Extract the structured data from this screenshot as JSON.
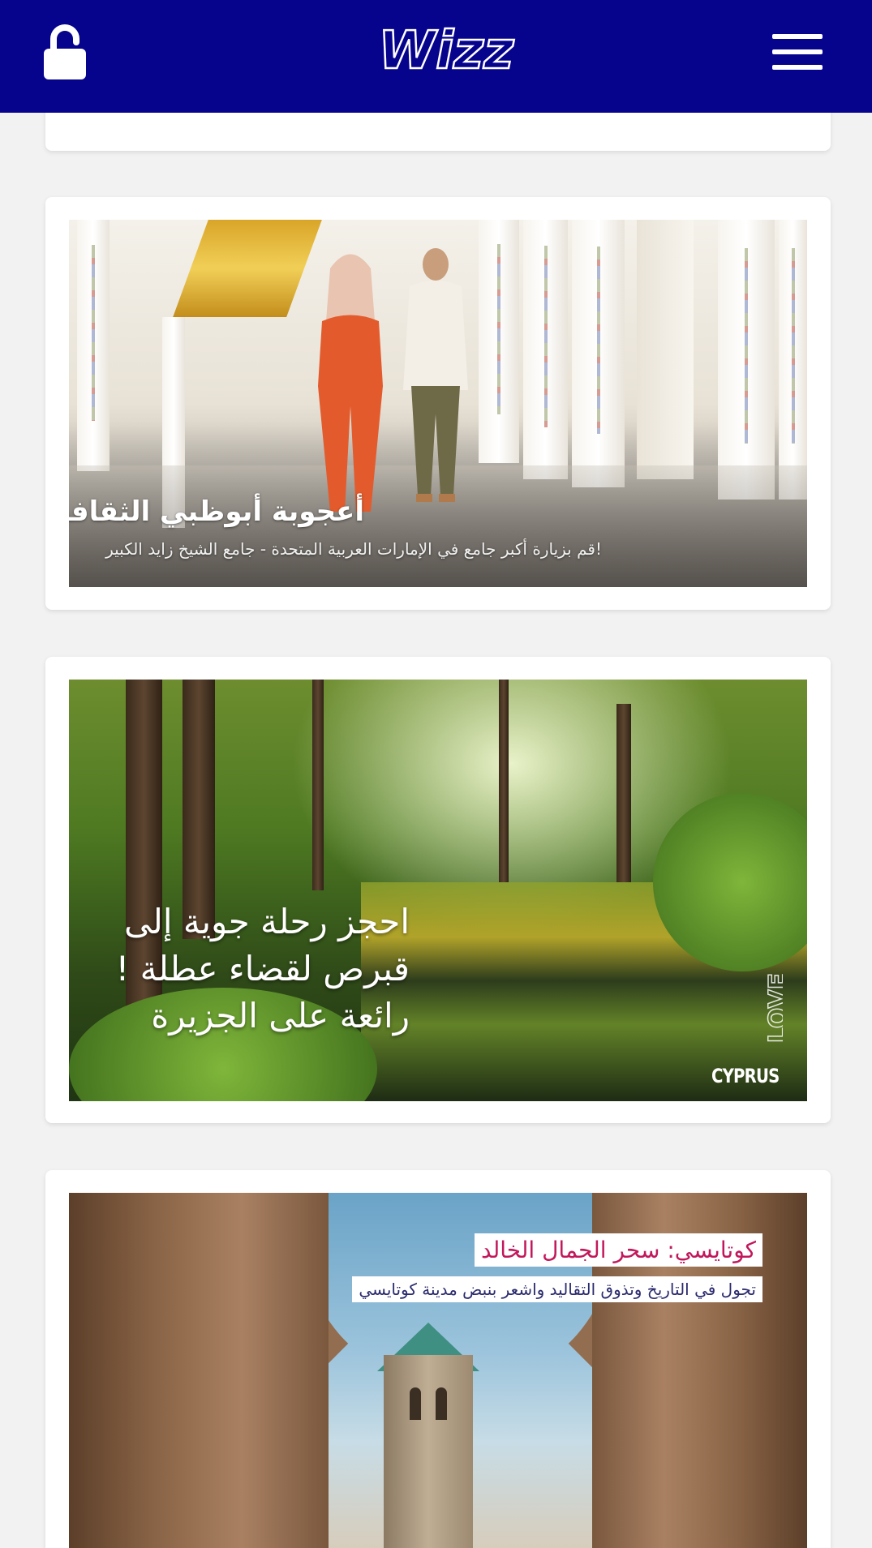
{
  "header": {
    "lock_icon": "unlock-icon",
    "logo_text": "Wizz",
    "menu_icon": "hamburger-menu-icon",
    "background_color": "#06038d"
  },
  "cards": [
    {
      "title": "أعجوبة أبوظبي الثقافية",
      "subtitle": "!قم بزيارة أكبر جامع في الإمارات العربية المتحدة - جامع الشيخ زايد الكبير"
    },
    {
      "title": "احجز رحلة جوية إلى قبرص لقضاء عطلة !رائعة على الجزيرة",
      "badge_logo_text": "LOVE",
      "badge_text": "CYPRUS"
    },
    {
      "title": "كوتايسي: سحر الجمال الخالد",
      "subtitle": "تجول في التاريخ وتذوق التقاليد واشعر بنبض مدينة كوتايسي",
      "title_color": "#c2185b"
    }
  ]
}
